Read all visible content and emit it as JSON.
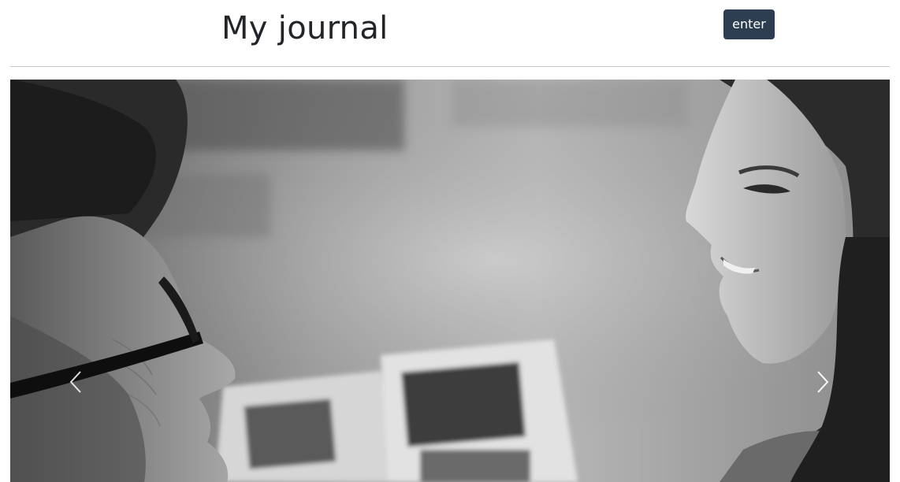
{
  "header": {
    "title": "My journal",
    "enter_label": "enter"
  },
  "carousel": {
    "slide_image": "grayscale-photo-older-woman-and-young-woman-smiling-face-to-face",
    "prev_icon": "chevron-left-icon",
    "next_icon": "chevron-right-icon"
  },
  "colors": {
    "title_text": "#212529",
    "button_bg": "#2c3e50",
    "button_text": "#ffffff",
    "divider": "#c9c9c9"
  }
}
